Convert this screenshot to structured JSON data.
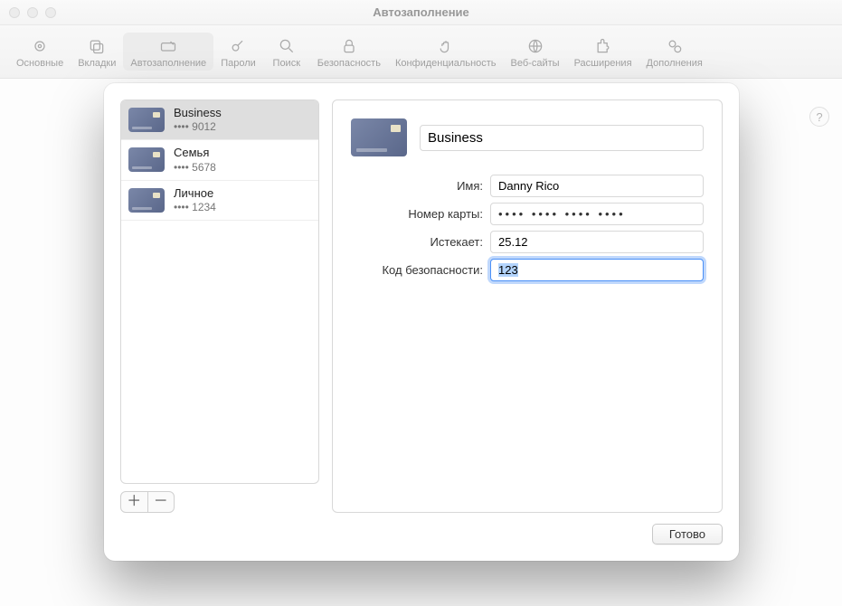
{
  "window_title": "Автозаполнение",
  "toolbar": {
    "items": [
      {
        "label": "Основные"
      },
      {
        "label": "Вкладки"
      },
      {
        "label": "Автозаполнение"
      },
      {
        "label": "Пароли"
      },
      {
        "label": "Поиск"
      },
      {
        "label": "Безопасность"
      },
      {
        "label": "Конфиденциальность"
      },
      {
        "label": "Веб-сайты"
      },
      {
        "label": "Расширения"
      },
      {
        "label": "Дополнения"
      }
    ],
    "active_index": 2
  },
  "help_symbol": "?",
  "cards": [
    {
      "name": "Business",
      "last4_prefix": "•••• ",
      "last4": "9012",
      "selected": true
    },
    {
      "name": "Семья",
      "last4_prefix": "•••• ",
      "last4": "5678",
      "selected": false
    },
    {
      "name": "Личное",
      "last4_prefix": "•••• ",
      "last4": "1234",
      "selected": false
    }
  ],
  "add_symbol": "＋",
  "remove_symbol": "－",
  "detail": {
    "title_value": "Business",
    "name_label": "Имя:",
    "name_value": "Danny Rico",
    "number_label": "Номер карты:",
    "number_value": "•••• •••• •••• ••••",
    "expires_label": "Истекает:",
    "expires_value": "25.12",
    "security_label": "Код безопасности:",
    "security_value": "123"
  },
  "done_label": "Готово"
}
